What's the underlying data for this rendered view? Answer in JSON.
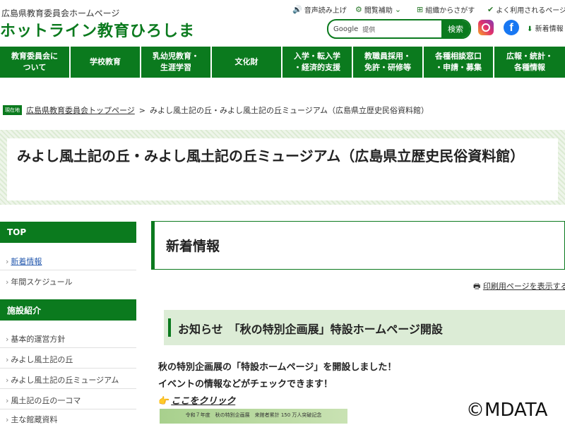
{
  "header": {
    "subtitle": "広島県教育委員会ホームページ",
    "title": "ホットライン教育ひろしま",
    "utility": {
      "read_aloud": "音声読み上げ",
      "browse_assist": "閲覧補助",
      "org_search": "組織からさがす",
      "popular": "よく利用されるページ"
    },
    "search": {
      "google_label": "Google",
      "placeholder": "提供",
      "button": "検索"
    },
    "news_link": "新着情報"
  },
  "nav": {
    "items": [
      "教育委員会に\nついて",
      "学校教育",
      "乳幼児教育・\n生涯学習",
      "文化財",
      "入学・転入学\n・経済的支援",
      "教職員採用・\n免許・研修等",
      "各種相談窓口\n・申請・募集",
      "広報・統計・\n各種情報"
    ]
  },
  "breadcrumb": {
    "here": "現在地",
    "home": "広島県教育委員会トップページ",
    "sep": ">",
    "current": "みよし風土記の丘・みよし風土記の丘ミュージアム（広島県立歴史民俗資料館）"
  },
  "page_title": "みよし風土記の丘・みよし風土記の丘ミュージアム（広島県立歴史民俗資料館）",
  "sidebar": {
    "top_heading": "TOP",
    "top_items": [
      "新着情報",
      "年間スケジュール"
    ],
    "facility_heading": "施設紹介",
    "facility_items": [
      "基本的運営方針",
      "みよし風土記の丘",
      "みよし風土記の丘ミュージアム",
      "風土記の丘の一コマ",
      "主な館蔵資料"
    ]
  },
  "main": {
    "section_heading": "新着情報",
    "print_link": "印刷用ページを表示する",
    "notice_title": "お知らせ　「秋の特別企画展」特設ホームページ開設",
    "body_line1": "秋の特別企画展の「特設ホームページ」を開設しました！",
    "body_line2": "イベントの情報などがチェックできます！",
    "click_link": "ここをクリック",
    "banner_text": "令和７年度　秋の特別企画展　来館者累計 150 万人突破記念"
  },
  "watermark": "©MDATA",
  "colors": {
    "brand_green": "#0b7a1e",
    "band_green": "#dcecd6"
  }
}
